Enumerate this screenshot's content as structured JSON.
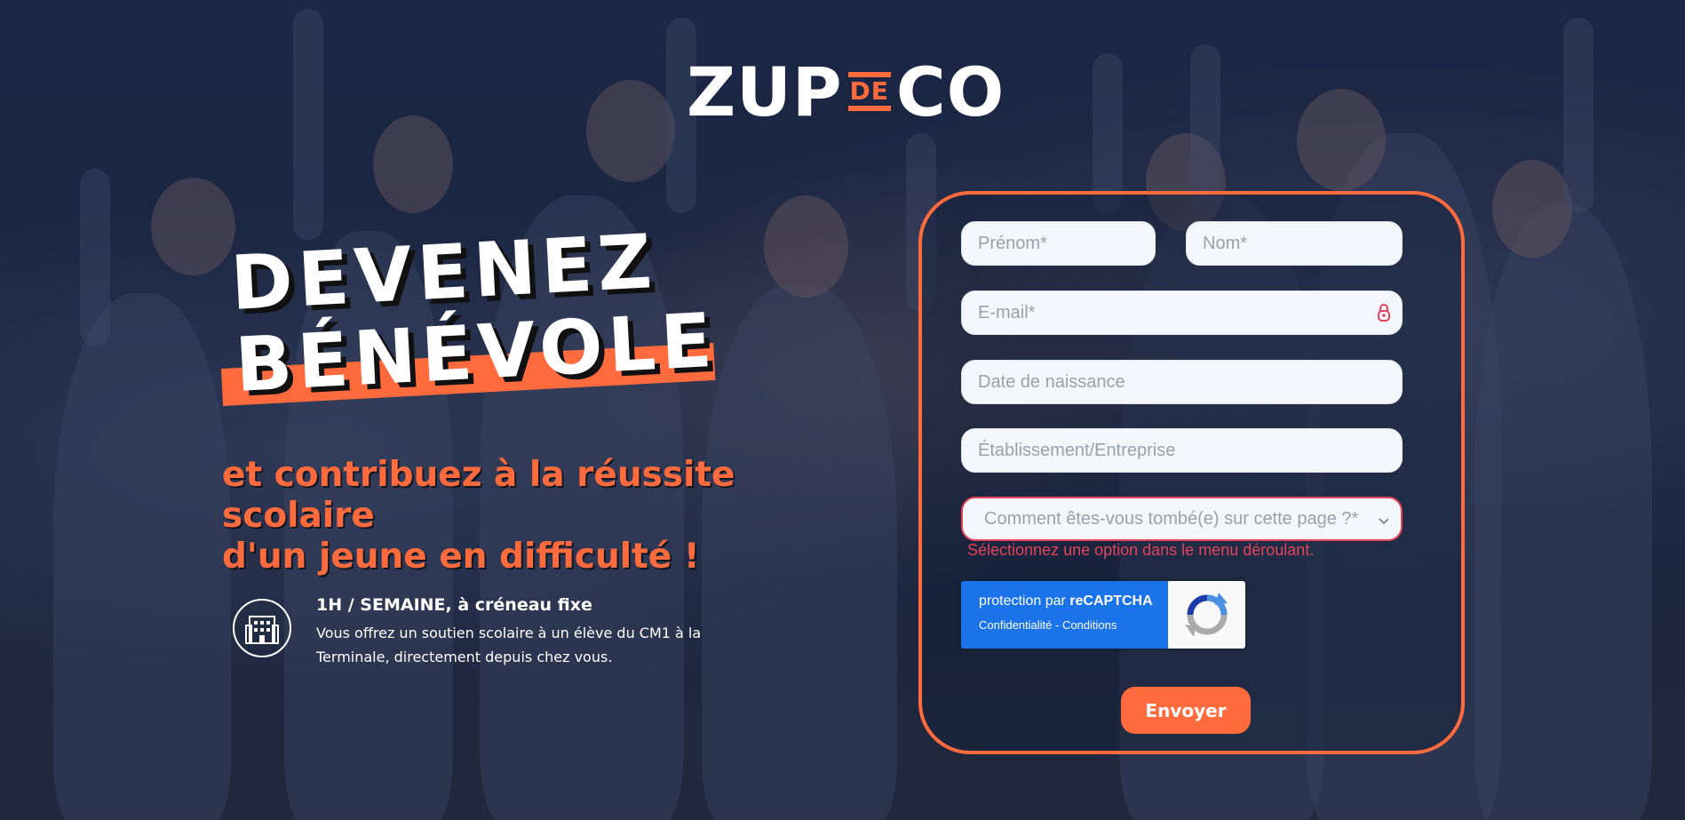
{
  "logo": {
    "part1": "ZUP",
    "part2": "DE",
    "part3": "CO"
  },
  "hero": {
    "title_line1": "DEVENEZ",
    "title_line2": "BÉNÉVOLE",
    "subtitle_line1": "et contribuez à la réussite scolaire",
    "subtitle_line2": "d'un jeune en difficulté !"
  },
  "feature": {
    "icon": "building-icon",
    "title": "1H / SEMAINE, à créneau fixe",
    "description": "Vous offrez un soutien scolaire à un élève du CM1 à la Terminale, directement depuis chez vous."
  },
  "form": {
    "firstname_placeholder": "Prénom*",
    "lastname_placeholder": "Nom*",
    "email_placeholder": "E-mail*",
    "birthdate_placeholder": "Date de naissance",
    "company_placeholder": "Établissement/Entreprise",
    "source_placeholder": "Comment êtes-vous tombé(e) sur cette page ?*",
    "source_error": "Sélectionnez une option dans le menu déroulant.",
    "captcha_prefix": "protection par ",
    "captcha_brand": "reCAPTCHA",
    "captcha_links": "Confidentialité - Conditions",
    "submit_label": "Envoyer"
  },
  "colors": {
    "accent": "#ff6b3d",
    "error": "#e2445c",
    "captcha_blue": "#1a73e8"
  }
}
